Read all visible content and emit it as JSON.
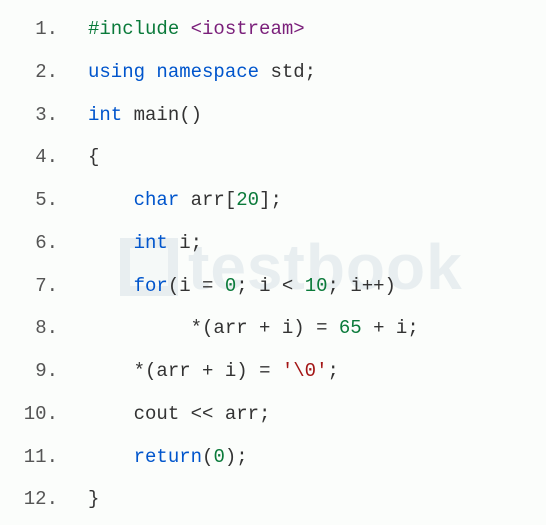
{
  "lines": [
    {
      "no": "1.",
      "tokens": [
        {
          "t": "#include",
          "c": "kw-pre"
        },
        {
          "t": " "
        },
        {
          "t": "<iostream>",
          "c": "hdr"
        }
      ]
    },
    {
      "no": "2.",
      "tokens": [
        {
          "t": "using",
          "c": "kw-using"
        },
        {
          "t": " "
        },
        {
          "t": "namespace",
          "c": "kw-ns"
        },
        {
          "t": " "
        },
        {
          "t": "std",
          "c": "ident-std"
        },
        {
          "t": ";"
        }
      ]
    },
    {
      "no": "3.",
      "tokens": [
        {
          "t": "int",
          "c": "kw-type"
        },
        {
          "t": " "
        },
        {
          "t": "main",
          "c": "fn"
        },
        {
          "t": "()",
          "c": "paren"
        }
      ]
    },
    {
      "no": "4.",
      "tokens": [
        {
          "t": "{",
          "c": "brace"
        }
      ]
    },
    {
      "no": "5.",
      "tokens": [
        {
          "t": "    "
        },
        {
          "t": "char",
          "c": "kw-type"
        },
        {
          "t": " "
        },
        {
          "t": "arr",
          "c": "ident"
        },
        {
          "t": "["
        },
        {
          "t": "20",
          "c": "num"
        },
        {
          "t": "];"
        }
      ]
    },
    {
      "no": "6.",
      "tokens": [
        {
          "t": "    "
        },
        {
          "t": "int",
          "c": "kw-type"
        },
        {
          "t": " "
        },
        {
          "t": "i",
          "c": "ident"
        },
        {
          "t": ";"
        }
      ]
    },
    {
      "no": "7.",
      "tokens": [
        {
          "t": "    "
        },
        {
          "t": "for",
          "c": "kw-for"
        },
        {
          "t": "("
        },
        {
          "t": "i",
          "c": "ident"
        },
        {
          "t": " = "
        },
        {
          "t": "0",
          "c": "num"
        },
        {
          "t": "; "
        },
        {
          "t": "i",
          "c": "ident"
        },
        {
          "t": " < "
        },
        {
          "t": "10",
          "c": "num"
        },
        {
          "t": "; "
        },
        {
          "t": "i",
          "c": "ident"
        },
        {
          "t": "++)"
        }
      ]
    },
    {
      "no": "8.",
      "tokens": [
        {
          "t": "         *("
        },
        {
          "t": "arr",
          "c": "ident"
        },
        {
          "t": " + "
        },
        {
          "t": "i",
          "c": "ident"
        },
        {
          "t": ") = "
        },
        {
          "t": "65",
          "c": "num"
        },
        {
          "t": " + "
        },
        {
          "t": "i",
          "c": "ident"
        },
        {
          "t": ";"
        }
      ]
    },
    {
      "no": "9.",
      "tokens": [
        {
          "t": "    *("
        },
        {
          "t": "arr",
          "c": "ident"
        },
        {
          "t": " + "
        },
        {
          "t": "i",
          "c": "ident"
        },
        {
          "t": ") = "
        },
        {
          "t": "'\\0'",
          "c": "str"
        },
        {
          "t": ";"
        }
      ]
    },
    {
      "no": "10.",
      "tokens": [
        {
          "t": "    "
        },
        {
          "t": "cout",
          "c": "ident"
        },
        {
          "t": " << "
        },
        {
          "t": "arr",
          "c": "ident"
        },
        {
          "t": ";"
        }
      ]
    },
    {
      "no": "11.",
      "tokens": [
        {
          "t": "    "
        },
        {
          "t": "return",
          "c": "kw-ret"
        },
        {
          "t": "("
        },
        {
          "t": "0",
          "c": "num"
        },
        {
          "t": ");"
        }
      ]
    },
    {
      "no": "12.",
      "tokens": [
        {
          "t": "}",
          "c": "brace"
        }
      ]
    }
  ],
  "watermark": "testbook"
}
